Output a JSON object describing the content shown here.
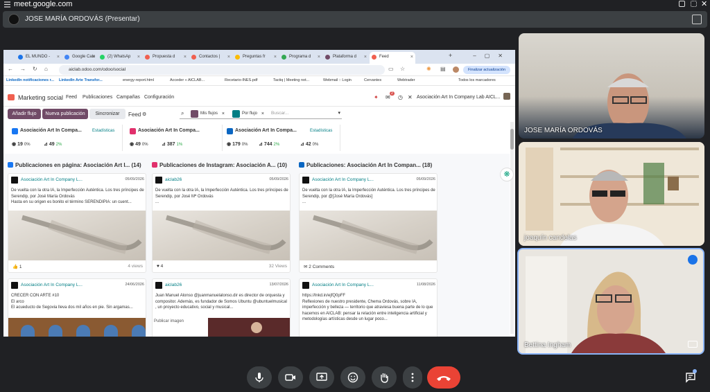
{
  "meet": {
    "url": "meet.google.com",
    "presenter_label": "JOSE MARÍA ORDOVÁS (Presentar)"
  },
  "browser": {
    "tabs": [
      {
        "label": "EL MUNDO -",
        "color": "#1a73e8"
      },
      {
        "label": "Google Cale",
        "color": "#4285f4"
      },
      {
        "label": "(2) WhatsAp",
        "color": "#25d366"
      },
      {
        "label": "Propuesta d",
        "color": "#f06050"
      },
      {
        "label": "Contactos |",
        "color": "#f06050"
      },
      {
        "label": "Preguntas fr",
        "color": "#fbbc04"
      },
      {
        "label": "Programa d",
        "color": "#34a853"
      },
      {
        "label": "Plataforma d",
        "color": "#714b67"
      },
      {
        "label": "Feed",
        "color": "#f06050"
      }
    ],
    "url": "aiclab.odoo.com/odoo/social",
    "update_button": "Finalizar actualización",
    "bookmarks": [
      "LinkedIn notificaciones r...",
      "LinkedIn Arte Transfor...",
      "energy-report.html",
      "Acceder « AICLAB...",
      "Recetario-INES.pdf",
      "Tactiq | Meeting not...",
      "Webmail :: Login",
      "Cervantes",
      "Webtrader",
      "Todos los marcadores"
    ]
  },
  "odoo": {
    "app_name": "Marketing social",
    "menu": [
      "Feed",
      "Publicaciones",
      "Campañas",
      "Configuración"
    ],
    "company": "Asociación Art In Company Lab AICL...",
    "notif_count": "2",
    "buttons": {
      "add_stream": "Añadir flujo",
      "new_post": "Nueva publicación",
      "sync": "Sincronizar"
    },
    "view_label": "Feed",
    "filters": [
      "Mis flujos",
      "Por flujo"
    ],
    "search_placeholder": "Buscar...",
    "accounts": [
      {
        "name": "Asociación Art In Compa...",
        "stats_link": "Estadísticas",
        "network": "facebook",
        "color": "#1877f2",
        "followers": "19",
        "followers_pct": "0%",
        "engagement": "49",
        "engagement_pct": "2%",
        "extra": "",
        "extra_pct": ""
      },
      {
        "name": "Asociación Art In Compa...",
        "stats_link": "Estadísticas",
        "network": "instagram",
        "color": "#e1306c",
        "followers": "49",
        "followers_pct": "0%",
        "engagement": "387",
        "engagement_pct": "1%",
        "extra": "",
        "extra_pct": ""
      },
      {
        "name": "Asociación Art In Compa...",
        "stats_link": "Estadísticas",
        "network": "linkedin",
        "color": "#0a66c2",
        "followers": "179",
        "followers_pct": "0%",
        "engagement": "744",
        "engagement_pct": "2%",
        "extra": "42",
        "extra_pct": "0%"
      }
    ],
    "columns": [
      {
        "title": "Publicaciones en página: Asociación Art I...",
        "count": "(14)",
        "color": "#1877f2",
        "cards": [
          {
            "author": "Asociación Art In Company L...",
            "date": "05/09/2026",
            "text": "De vuelta con la otra IA, la Imperfección Auténtica. Los tres príncipes de Serendip, por José María Ordovás\nHasta en su origen es bonito el término SERENDIPIA: un cuent...",
            "footer_icon": "like-icon",
            "footer_count": "1",
            "footer_extra": "4 views"
          },
          {
            "author": "Asociación Art In Company L...",
            "date": "24/06/2026",
            "text": "CRECER CON ARTE #10\nEl arco\nEl acueducto de Segovia lleva dos mil años en pie. Sin argamas...",
            "footer_icon": "",
            "footer_count": "",
            "footer_extra": ""
          }
        ]
      },
      {
        "title": "Publicaciones de Instagram: Asociación A...",
        "count": "(10)",
        "color": "#e1306c",
        "cards": [
          {
            "author": "aiclab26",
            "date": "05/09/2026",
            "text": "De vuelta con la otra IA, la Imperfección Auténtica. Los tres príncipes de Serendip, por José Mª Ordovás\n...",
            "footer_icon": "heart-icon",
            "footer_count": "4",
            "footer_extra": "32 Views"
          },
          {
            "author": "aiclab26",
            "date": "13/07/2026",
            "text": "Juan Manuel Alonso @juanmanuelalonso.dir es director de orquesta y compositor. Además, es fundador de Somos Ubuntu @ubuntuelmusical , un proyecto educativo, social y musical...",
            "image_alt": "Publicar imagen",
            "footer_icon": "",
            "footer_count": "",
            "footer_extra": ""
          }
        ]
      },
      {
        "title": "Publicaciones: Asociación Art In Compan...",
        "count": "(18)",
        "color": "#0a66c2",
        "cards": [
          {
            "author": "Asociación Art In Company L...",
            "date": "05/09/2026",
            "text": "De vuelta con la otra IA, la Imperfección Auténtica. Los tres príncipes de Serendip, por @[José María Ordovás]\n...",
            "footer_icon": "comment-icon",
            "footer_count": "2",
            "footer_extra": "Comments"
          },
          {
            "author": "Asociación Art In Company L...",
            "date": "11/08/2026",
            "text": "https://lnkd.in/ejfQ0pFF\nReflexiones de nuestro presidente, Chema Ordovás, sobre IA, imperfección y belleza — territorio que atraviesa buena parte de lo que hacemos en AICLAB: pensar la relación entre inteligencia artificial y metodologías artísticas desde un lugar poco...",
            "footer_icon": "",
            "footer_count": "",
            "footer_extra": ""
          }
        ]
      }
    ]
  },
  "participants": [
    {
      "name": "JOSE MARÍA ORDOVÁS"
    },
    {
      "name": "joaquín candelas"
    },
    {
      "name": "Bettina Ingham"
    }
  ],
  "controls": [
    "mic-button",
    "camera-button",
    "present-button",
    "reactions-button",
    "raise-hand-button",
    "more-options-button",
    "leave-call-button"
  ]
}
